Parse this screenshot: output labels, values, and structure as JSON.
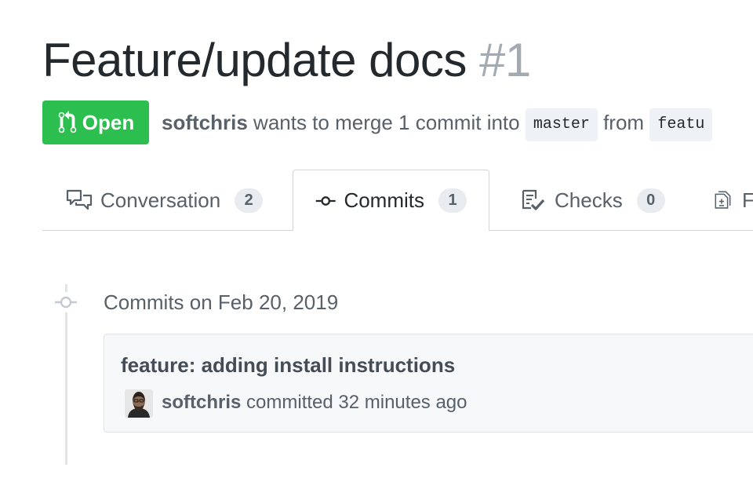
{
  "pr": {
    "title": "Feature/update docs",
    "number": "#1",
    "state": "Open",
    "state_color": "#2cbe4e",
    "author": "softchris",
    "merge_text_1": " wants to merge 1 commit into ",
    "base_branch": "master",
    "merge_text_2": " from ",
    "head_branch": "featu"
  },
  "tabs": [
    {
      "label": "Conversation",
      "count": "2",
      "icon": "comment-discussion-icon"
    },
    {
      "label": "Commits",
      "count": "1",
      "icon": "git-commit-icon",
      "selected": true
    },
    {
      "label": "Checks",
      "count": "0",
      "icon": "checklist-icon"
    },
    {
      "label": "F",
      "icon": "file-diff-icon"
    }
  ],
  "commits": {
    "heading": "Commits on Feb 20, 2019",
    "items": [
      {
        "message": "feature: adding install instructions",
        "author": "softchris",
        "action_time": " committed 32 minutes ago"
      }
    ]
  }
}
